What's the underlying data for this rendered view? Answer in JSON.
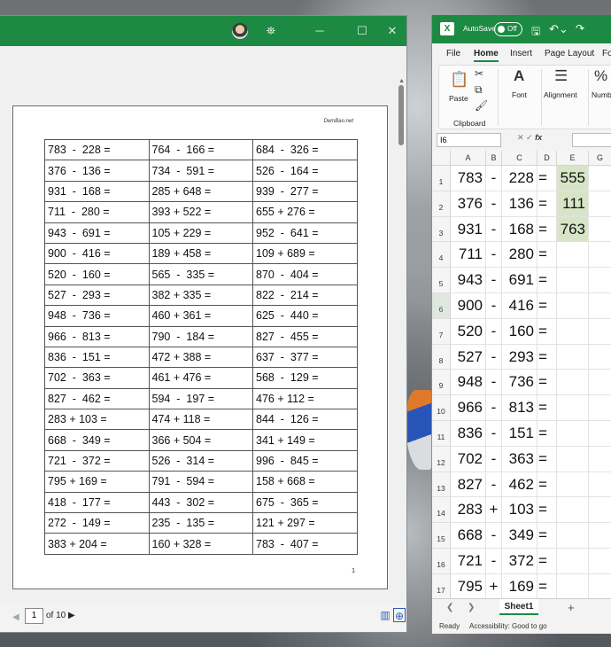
{
  "pdf_viewer": {
    "page_brand": "DemBao.net",
    "page_number": "1",
    "worksheet_rows": [
      [
        "783  -  228 =",
        "764  -  166 =",
        "684  -  326 ="
      ],
      [
        "376  -  136 =",
        "734  -  591 =",
        "526  -  164 ="
      ],
      [
        "931  -  168 =",
        "285 + 648 =",
        "939  -  277 ="
      ],
      [
        "711  -  280 =",
        "393 + 522 =",
        "655 + 276 ="
      ],
      [
        "943  -  691 =",
        "105 + 229 =",
        "952  -  641 ="
      ],
      [
        "900  -  416 =",
        "189 + 458 =",
        "109 + 689 ="
      ],
      [
        "520  -  160 =",
        "565  -  335 =",
        "870  -  404 ="
      ],
      [
        "527  -  293 =",
        "382 + 335 =",
        "822  -  214 ="
      ],
      [
        "948  -  736 =",
        "460 + 361 =",
        "625  -  440 ="
      ],
      [
        "966  -  813 =",
        "790  -  184 =",
        "827  -  455 ="
      ],
      [
        "836  -  151 =",
        "472 + 388 =",
        "637  -  377 ="
      ],
      [
        "702  -  363 =",
        "461 + 476 =",
        "568  -  129 ="
      ],
      [
        "827  -  462 =",
        "594  -  197 =",
        "476 + 112 ="
      ],
      [
        "283 + 103 =",
        "474 + 118 =",
        "844  -  126 ="
      ],
      [
        "668  -  349 =",
        "366 + 504 =",
        "341 + 149 ="
      ],
      [
        "721  -  372 =",
        "526  -  314 =",
        "996  -  845 ="
      ],
      [
        "795 + 169 =",
        "791  -  594 =",
        "158 + 668 ="
      ],
      [
        "418  -  177 =",
        "443  -  302 =",
        "675  -  365 ="
      ],
      [
        "272  -  149 =",
        "235  -  135 =",
        "121 + 297 ="
      ],
      [
        "383 + 204 =",
        "160 + 328 =",
        "783  -  407 ="
      ]
    ],
    "footer": {
      "current_page": "1",
      "of_label": "of 10"
    }
  },
  "excel": {
    "autosave_label": "AutoSave",
    "autosave_state": "Off",
    "tabs": [
      "File",
      "Home",
      "Insert",
      "Page Layout",
      "Fo"
    ],
    "ribbon": {
      "paste_label": "Paste",
      "clipboard_label": "Clipboard",
      "font_label": "Font",
      "alignment_label": "Alignment",
      "number_label": "Numbe"
    },
    "name_box": "I6",
    "fx_label": "fx",
    "columns": [
      "A",
      "B",
      "C",
      "D",
      "E",
      "G"
    ],
    "rows": [
      {
        "n": "1",
        "a": "783",
        "b": "-",
        "c": "228",
        "d": "=",
        "e": "555"
      },
      {
        "n": "2",
        "a": "376",
        "b": "-",
        "c": "136",
        "d": "=",
        "e": "111"
      },
      {
        "n": "3",
        "a": "931",
        "b": "-",
        "c": "168",
        "d": "=",
        "e": "763"
      },
      {
        "n": "4",
        "a": "711",
        "b": "-",
        "c": "280",
        "d": "=",
        "e": ""
      },
      {
        "n": "5",
        "a": "943",
        "b": "-",
        "c": "691",
        "d": "=",
        "e": ""
      },
      {
        "n": "6",
        "a": "900",
        "b": "-",
        "c": "416",
        "d": "=",
        "e": ""
      },
      {
        "n": "7",
        "a": "520",
        "b": "-",
        "c": "160",
        "d": "=",
        "e": ""
      },
      {
        "n": "8",
        "a": "527",
        "b": "-",
        "c": "293",
        "d": "=",
        "e": ""
      },
      {
        "n": "9",
        "a": "948",
        "b": "-",
        "c": "736",
        "d": "=",
        "e": ""
      },
      {
        "n": "10",
        "a": "966",
        "b": "-",
        "c": "813",
        "d": "=",
        "e": ""
      },
      {
        "n": "11",
        "a": "836",
        "b": "-",
        "c": "151",
        "d": "=",
        "e": ""
      },
      {
        "n": "12",
        "a": "702",
        "b": "-",
        "c": "363",
        "d": "=",
        "e": ""
      },
      {
        "n": "13",
        "a": "827",
        "b": "-",
        "c": "462",
        "d": "=",
        "e": ""
      },
      {
        "n": "14",
        "a": "283",
        "b": "+",
        "c": "103",
        "d": "=",
        "e": ""
      },
      {
        "n": "15",
        "a": "668",
        "b": "-",
        "c": "349",
        "d": "=",
        "e": ""
      },
      {
        "n": "16",
        "a": "721",
        "b": "-",
        "c": "372",
        "d": "=",
        "e": ""
      },
      {
        "n": "17",
        "a": "795",
        "b": "+",
        "c": "169",
        "d": "=",
        "e": ""
      }
    ],
    "sheet_tab": "Sheet1",
    "status": {
      "ready": "Ready",
      "accessibility": "Accessibility: Good to go"
    },
    "colors": {
      "brand_green": "#1c8a42",
      "answer_fill": "#d7e5c6"
    }
  }
}
